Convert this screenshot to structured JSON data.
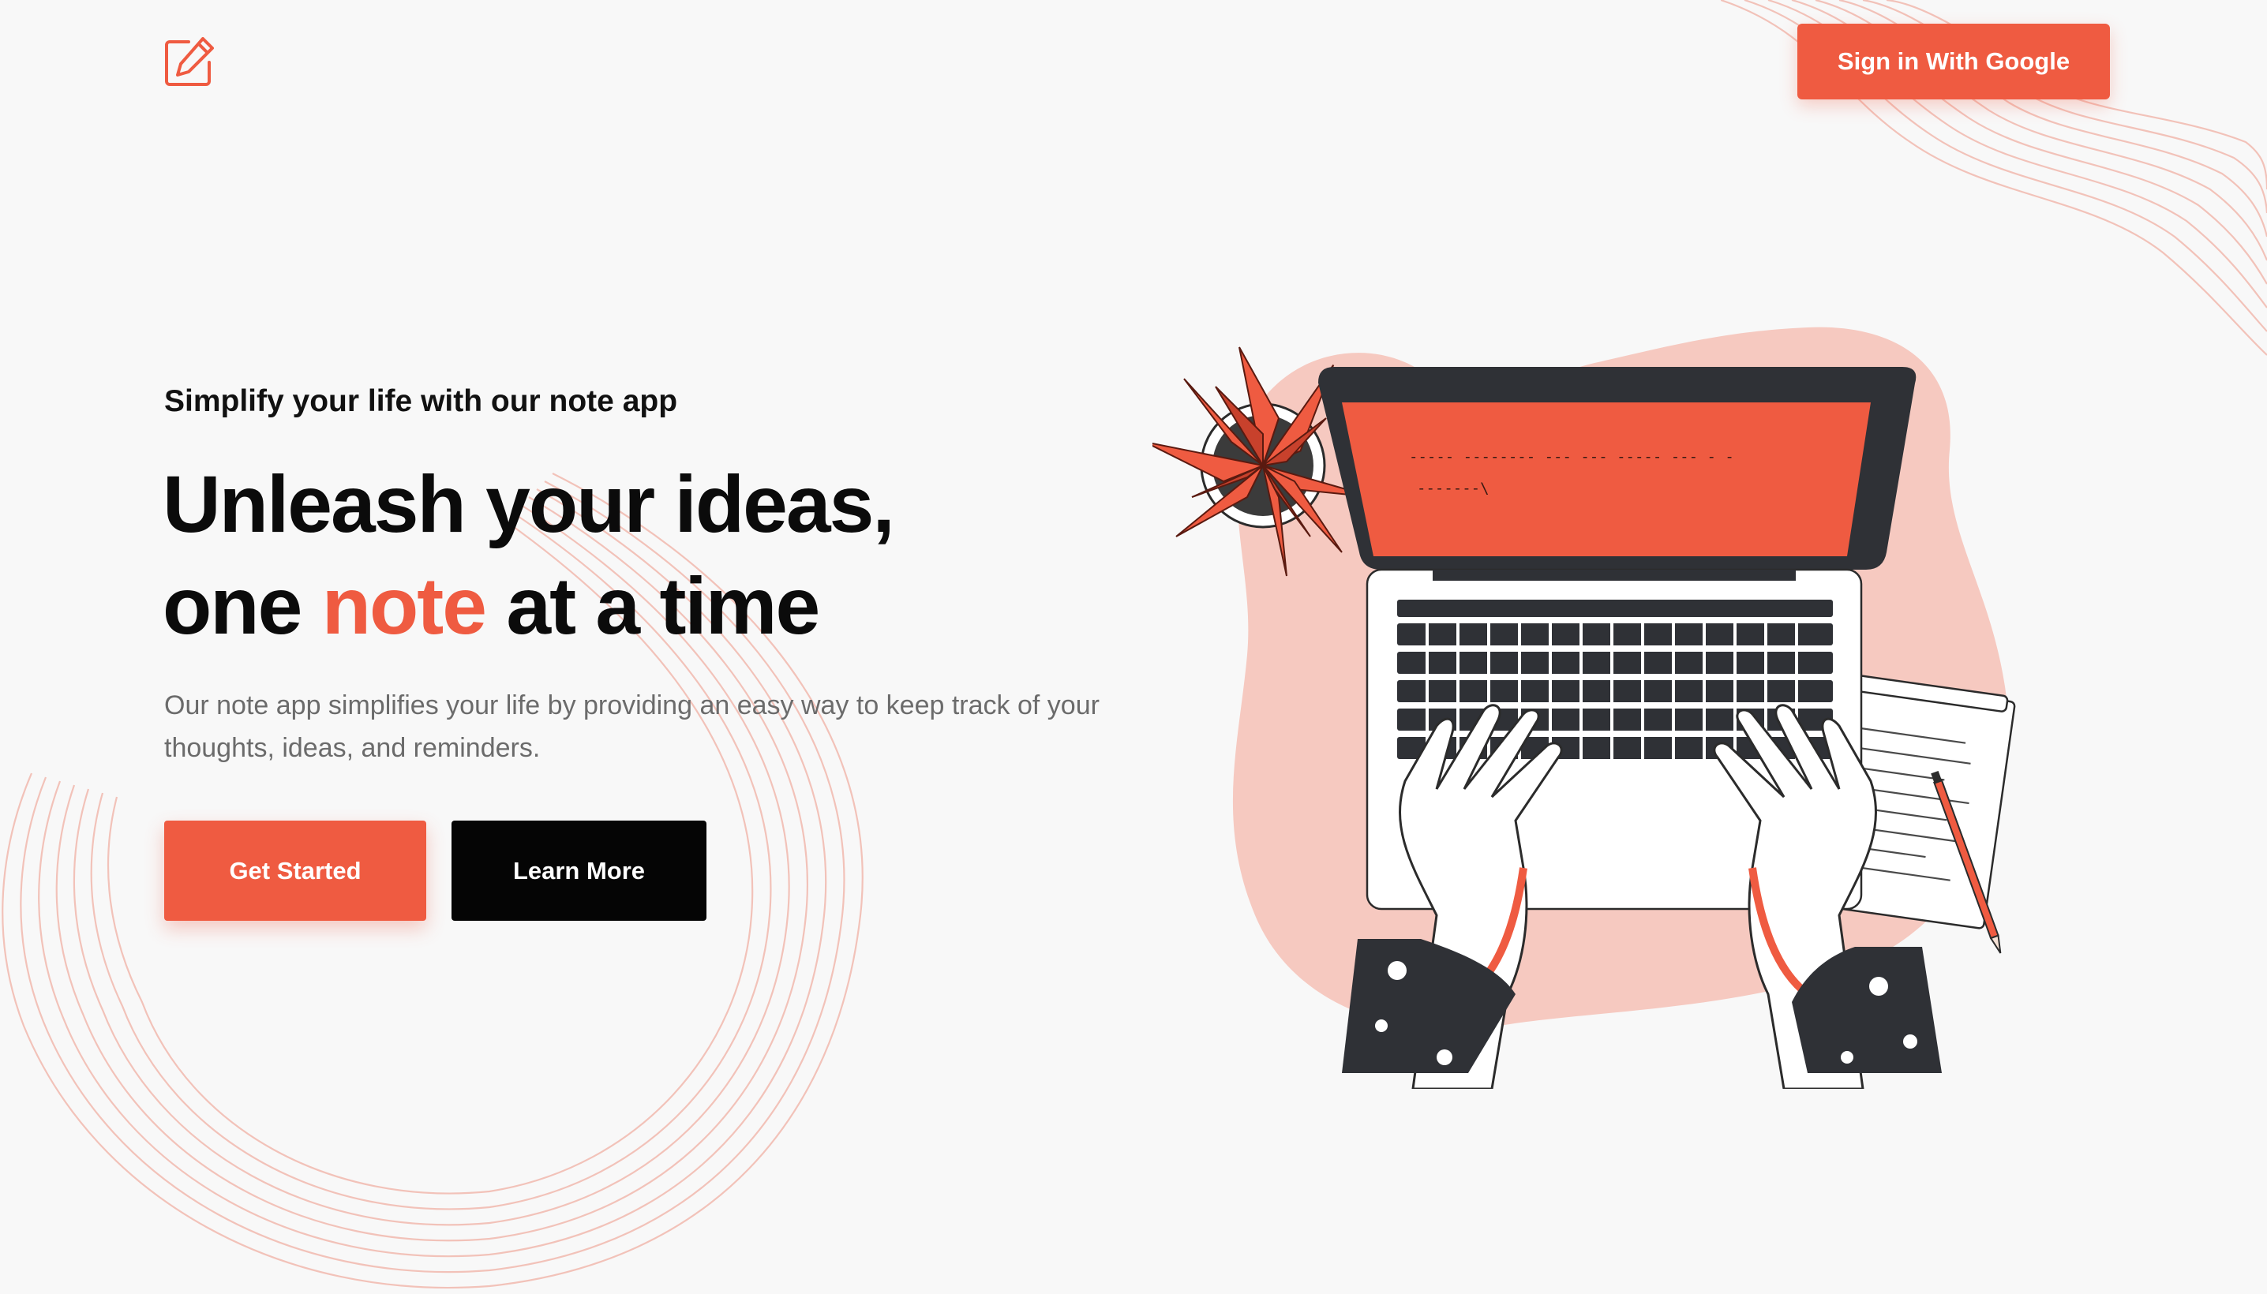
{
  "nav": {
    "logo_icon": "edit-note-icon",
    "signin_label": "Sign in With Google"
  },
  "hero": {
    "tagline": "Simplify your life with our note app",
    "headline_line1": "Unleash your ideas,",
    "headline_line2_pre": "one ",
    "headline_accent": "note",
    "headline_line2_post": " at a time",
    "description": "Our note app simplifies your life by providing an easy way to keep track of your thoughts, ideas, and reminders.",
    "primary_cta": "Get Started",
    "secondary_cta": "Learn More"
  },
  "illustration": {
    "subject": "laptop-typing-illustration",
    "screen_text_line1": "----- -------- --- ---     ----- --- - -",
    "screen_text_line2": "-------\\"
  },
  "theme": {
    "accent": "#ef5b41",
    "accent_light": "#f6c9c0",
    "background": "#f8f8f8",
    "text_dark": "#0b0b0b",
    "text_muted": "#6b6b6b"
  }
}
